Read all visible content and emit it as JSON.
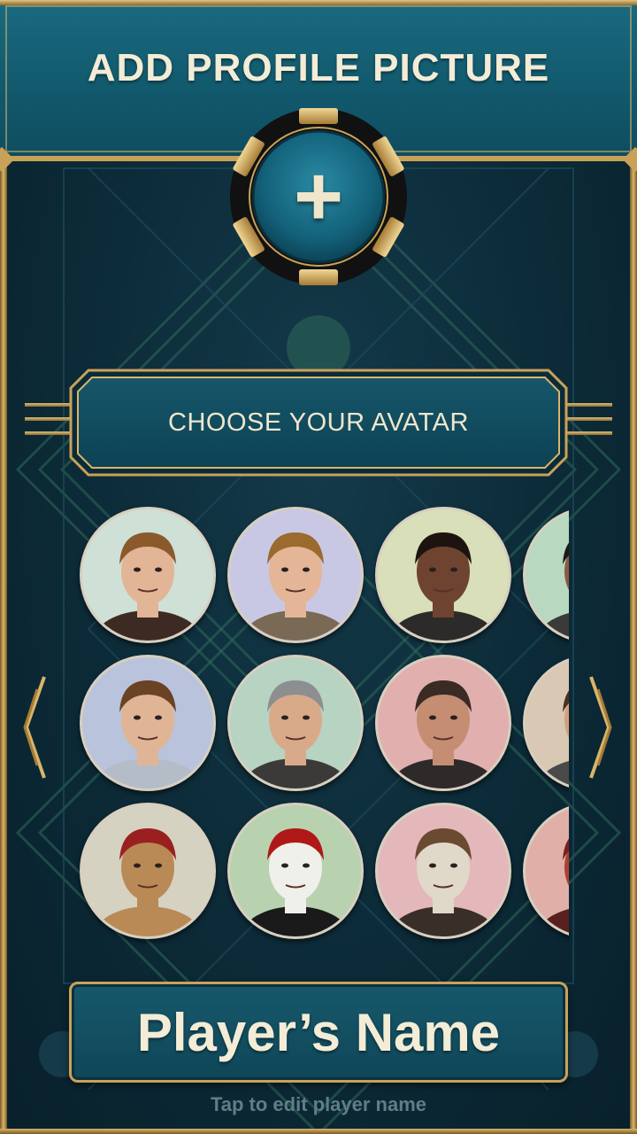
{
  "header": {
    "title": "ADD PROFILE PICTURE"
  },
  "add_photo": {
    "icon": "plus-icon",
    "glyph": "+"
  },
  "avatar_section": {
    "title": "CHOOSE YOUR AVATAR"
  },
  "avatars": [
    {
      "id": "man-blond-stubble",
      "bg": "#cfe0d6",
      "skin": "#e2b596",
      "hair": "#8a5a2c",
      "cloth": "#3d2a22"
    },
    {
      "id": "woman-long-hair",
      "bg": "#c9c8e4",
      "skin": "#e4b596",
      "hair": "#9a6a2e",
      "cloth": "#7a6a55"
    },
    {
      "id": "man-goatee",
      "bg": "#d9dfb8",
      "skin": "#6e4430",
      "hair": "#1d1410",
      "cloth": "#2d2a2a"
    },
    {
      "id": "partial-avatar-1",
      "bg": "#b8d8c0",
      "skin": "#8a5a40",
      "hair": "#1a1a1a",
      "cloth": "#3a3a3a"
    },
    {
      "id": "man-brown-hair",
      "bg": "#b9c4dc",
      "skin": "#e0b596",
      "hair": "#6a4224",
      "cloth": "#b4bcc8"
    },
    {
      "id": "man-gray-hair",
      "bg": "#b7d3c2",
      "skin": "#d9aa8a",
      "hair": "#8d8e90",
      "cloth": "#3c3a38"
    },
    {
      "id": "man-slicked-hair",
      "bg": "#e1b0ae",
      "skin": "#c58d72",
      "hair": "#3a2b24",
      "cloth": "#2e2a2a"
    },
    {
      "id": "partial-avatar-2",
      "bg": "#d8c8b4",
      "skin": "#d2a07e",
      "hair": "#4a3020",
      "cloth": "#4a4a4a"
    },
    {
      "id": "camel-fez",
      "bg": "#d6d2c2",
      "skin": "#b98a55",
      "hair": "#9a2020",
      "cloth": "#b98a55"
    },
    {
      "id": "panda-cap",
      "bg": "#b8d2b0",
      "skin": "#f0f0ea",
      "hair": "#b01818",
      "cloth": "#1a1a1a"
    },
    {
      "id": "skull-fedora",
      "bg": "#e4b8ba",
      "skin": "#e0d8c8",
      "hair": "#6a4a30",
      "cloth": "#3a2e28"
    },
    {
      "id": "partial-avatar-3",
      "bg": "#e0b0a8",
      "skin": "#b04030",
      "hair": "#7a2020",
      "cloth": "#5a2020"
    }
  ],
  "nav": {
    "prev": "chevron-left-icon",
    "next": "chevron-right-icon"
  },
  "player": {
    "name": "Player’s Name",
    "hint": "Tap to edit player name"
  },
  "colors": {
    "gold": "#c9a258",
    "teal": "#125a6e",
    "background": "#0b2632",
    "text": "#f3ecd6"
  }
}
